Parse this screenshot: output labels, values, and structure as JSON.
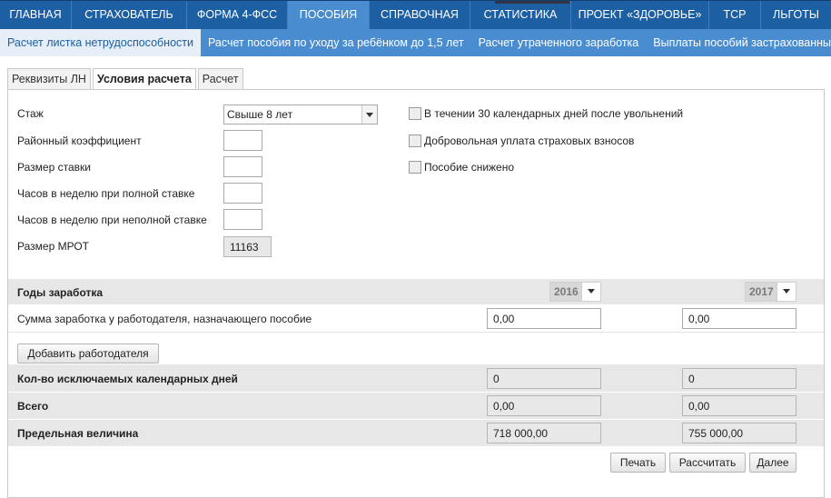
{
  "topnav": {
    "items": [
      {
        "label": "ГЛАВНАЯ"
      },
      {
        "label": "СТРАХОВАТЕЛЬ"
      },
      {
        "label": "ФОРМА 4-ФСС"
      },
      {
        "label": "ПОСОБИЯ"
      },
      {
        "label": "СПРАВОЧНАЯ"
      },
      {
        "label": "СТАТИСТИКА"
      },
      {
        "label": "ПРОЕКТ «ЗДОРОВЬЕ»"
      },
      {
        "label": "ТСР"
      },
      {
        "label": "ЛЬГОТЫ"
      }
    ],
    "active_index": 3
  },
  "subnav": {
    "items": [
      {
        "label": "Расчет листка нетрудоспособности"
      },
      {
        "label": "Расчет пособия по уходу за ребёнком до 1,5 лет"
      },
      {
        "label": "Расчет утраченного заработка"
      },
      {
        "label": "Выплаты пособий застрахованным"
      }
    ],
    "active_index": 0
  },
  "tabs": [
    {
      "label": "Реквизиты ЛН"
    },
    {
      "label": "Условия расчета"
    },
    {
      "label": "Расчет"
    }
  ],
  "form": {
    "stazh_label": "Стаж",
    "stazh_value": "Свыше 8 лет",
    "rayon_label": "Районный коэффициент",
    "rayon_value": "",
    "stavka_label": "Размер ставки",
    "stavka_value": "",
    "full_hours_label": "Часов в неделю при полной ставке",
    "full_hours_value": "",
    "part_hours_label": "Часов в неделю при неполной ставке",
    "part_hours_value": "",
    "mrot_label": "Размер МРОТ",
    "mrot_value": "11163"
  },
  "checks": {
    "after_dismissal": "В течении 30 календарных дней после увольнений",
    "voluntary": "Добровольная уплата страховых взносов",
    "reduced": "Пособие снижено"
  },
  "earnings": {
    "years_label": "Годы заработка",
    "year1": "2016",
    "year2": "2017",
    "sum_label": "Сумма заработка у работодателя, назначающего пособие",
    "sum1": "0,00",
    "sum2": "0,00",
    "add_employer": "Добавить работодателя",
    "excluded_label": "Кол-во исключаемых календарных дней",
    "excluded1": "0",
    "excluded2": "0",
    "total_label": "Всего",
    "total1": "0,00",
    "total2": "0,00",
    "limit_label": "Предельная величина",
    "limit1": "718 000,00",
    "limit2": "755 000,00"
  },
  "buttons": {
    "print": "Печать",
    "calculate": "Рассчитать",
    "next": "Далее"
  }
}
